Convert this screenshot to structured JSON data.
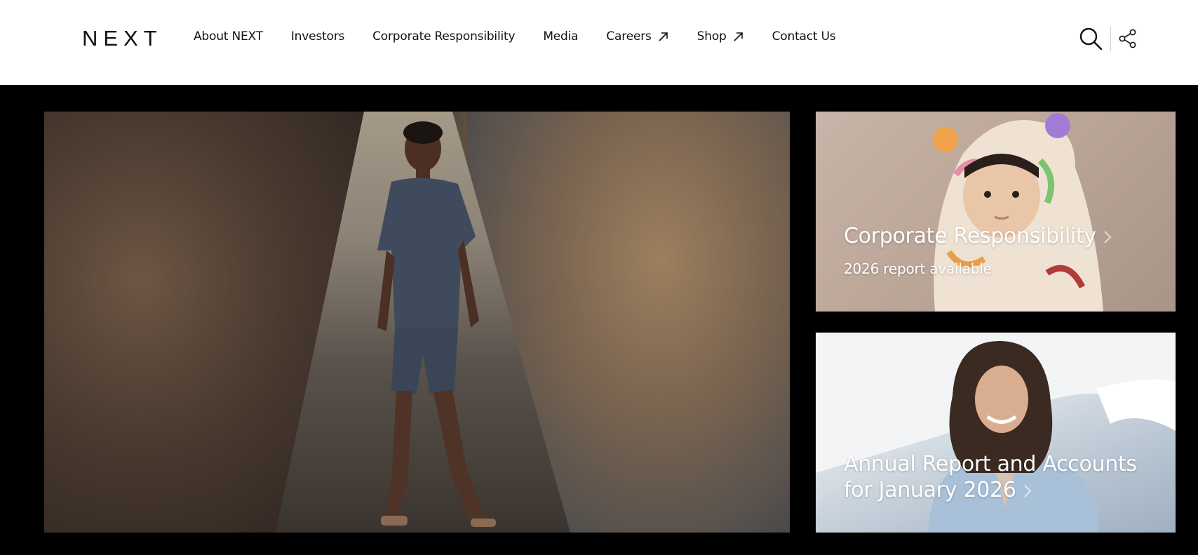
{
  "brand": {
    "logo_text": "NEXT"
  },
  "nav": {
    "items": [
      {
        "label": "About NEXT",
        "external": false
      },
      {
        "label": "Investors",
        "external": false
      },
      {
        "label": "Corporate Responsibility",
        "external": false
      },
      {
        "label": "Media",
        "external": false
      },
      {
        "label": "Careers",
        "external": true
      },
      {
        "label": "Shop",
        "external": true
      },
      {
        "label": "Contact Us",
        "external": false
      }
    ]
  },
  "utility": {
    "search_icon": "search-icon",
    "share_icon": "share-icon"
  },
  "hero": {
    "image": "boy-on-stone-stairway-photo"
  },
  "cards": {
    "corporate": {
      "title": "Corporate Responsibility",
      "subtitle": "2026 report available",
      "image": "child-in-patterned-hoodie-photo"
    },
    "annual": {
      "title": "Annual Report and Accounts for January 2026",
      "image": "woman-in-blue-blazer-photo"
    }
  },
  "colors": {
    "header_bg": "#ffffff",
    "page_bg": "#000000",
    "text_dark": "#111111",
    "card_text": "#ffffff"
  }
}
